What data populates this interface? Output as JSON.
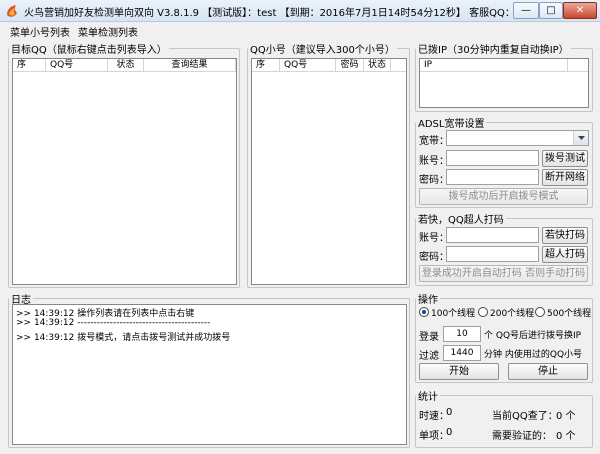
{
  "window": {
    "title": "火鸟营销加好友检测单向双向 V3.8.1.9 【测试版】：test 【到期：2016年7月1日14时54分12秒】 客服QQ：303..."
  },
  "window_buttons": {
    "minimize": "—",
    "maximize": "□",
    "close": "✕"
  },
  "menu": {
    "items": [
      "菜单小号列表",
      "菜单检测列表"
    ]
  },
  "target_group": {
    "title": "目标QQ（鼠标右键点击列表导入）",
    "columns": [
      "序",
      "QQ号",
      "状态",
      "查询结果"
    ]
  },
  "small_group": {
    "title": "QQ小号（建议导入300个小号）",
    "columns": [
      "序",
      "QQ号",
      "密码",
      "状态"
    ]
  },
  "ip_group": {
    "title": "已拨IP（30分钟内重复自动换IP）",
    "columns": [
      "IP"
    ]
  },
  "adsl_group": {
    "title": "ADSL宽带设置",
    "broadband_label": "宽带：",
    "broadband_value": "",
    "account_label": "账号：",
    "account_value": "",
    "password_label": "密码：",
    "password_value": "",
    "dial_test_button": "拨号测试",
    "disconnect_button": "断开网络",
    "dial_success_button": "拨号成功后开启拨号模式"
  },
  "ruokuai_group": {
    "title": "若快，QQ超人打码",
    "account_label": "账号：",
    "account_value": "",
    "password_label": "密码：",
    "password_value": "",
    "ruokuai_button": "若快打码",
    "chaoren_button": "超人打码",
    "auto_code_button": "登录成功开启自动打码 否则手动打码"
  },
  "log_group": {
    "title": "日志",
    "lines": [
      ">> 14:39:12   操作列表请在列表中点击右键",
      ">> 14:39:12   -----------------------------------------",
      ">> 14:39:12   拨号模式，请点击拨号测试并成功拨号"
    ]
  },
  "operation_group": {
    "title": "操作",
    "thread_options": [
      "100个线程",
      "200个线程",
      "500个线程"
    ],
    "selected_thread": "100个线程",
    "login_label": "登录",
    "login_count": "10",
    "login_suffix": "个  QQ号后进行拨号换IP",
    "filter_label": "过滤",
    "filter_minutes": "1440",
    "filter_suffix": "分钟  内使用过的QQ小号",
    "start_button": "开始",
    "stop_button": "停止"
  },
  "stats_group": {
    "title": "统计",
    "time_label": "时速：",
    "time_value": "0",
    "queried_label": "当前QQ查了：",
    "queried_value": "0 个",
    "single_label": "单项：",
    "single_value": "0",
    "verify_label": "需要验证的：",
    "verify_value": "0 个"
  },
  "colors": {
    "titlebar_top": "#eaf2fb",
    "titlebar_bottom": "#d7e4f3",
    "window_bg": "#f0f0f0",
    "close_button": "#c9462f"
  }
}
